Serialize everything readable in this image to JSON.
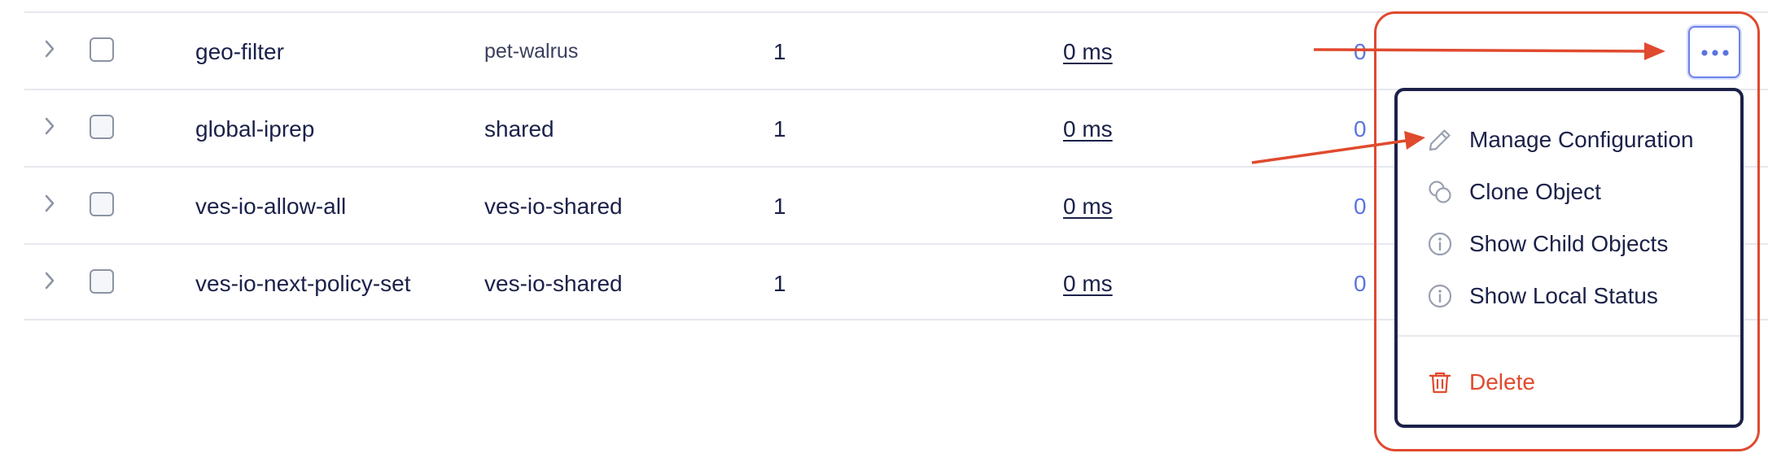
{
  "rows": [
    {
      "name": "geo-filter",
      "namespace": "pet-walrus",
      "version": "1",
      "latency": "0 ms",
      "count": "0"
    },
    {
      "name": "global-iprep",
      "namespace": "shared",
      "version": "1",
      "latency": "0 ms",
      "count": "0"
    },
    {
      "name": "ves-io-allow-all",
      "namespace": "ves-io-shared",
      "version": "1",
      "latency": "0 ms",
      "count": "0"
    },
    {
      "name": "ves-io-next-policy-set",
      "namespace": "ves-io-shared",
      "version": "1",
      "latency": "0 ms",
      "count": "0"
    }
  ],
  "menu": {
    "items": [
      {
        "label": "Manage Configuration",
        "icon": "pencil-icon"
      },
      {
        "label": "Clone Object",
        "icon": "clone-icon"
      },
      {
        "label": "Show Child Objects",
        "icon": "info-icon"
      },
      {
        "label": "Show Local Status",
        "icon": "info-icon"
      }
    ],
    "delete_label": "Delete",
    "delete_icon": "trash-icon"
  },
  "colors": {
    "text": "#1b2149",
    "link": "#5b74e0",
    "annotation": "#e04a2e",
    "menu_border": "#1b2149"
  }
}
